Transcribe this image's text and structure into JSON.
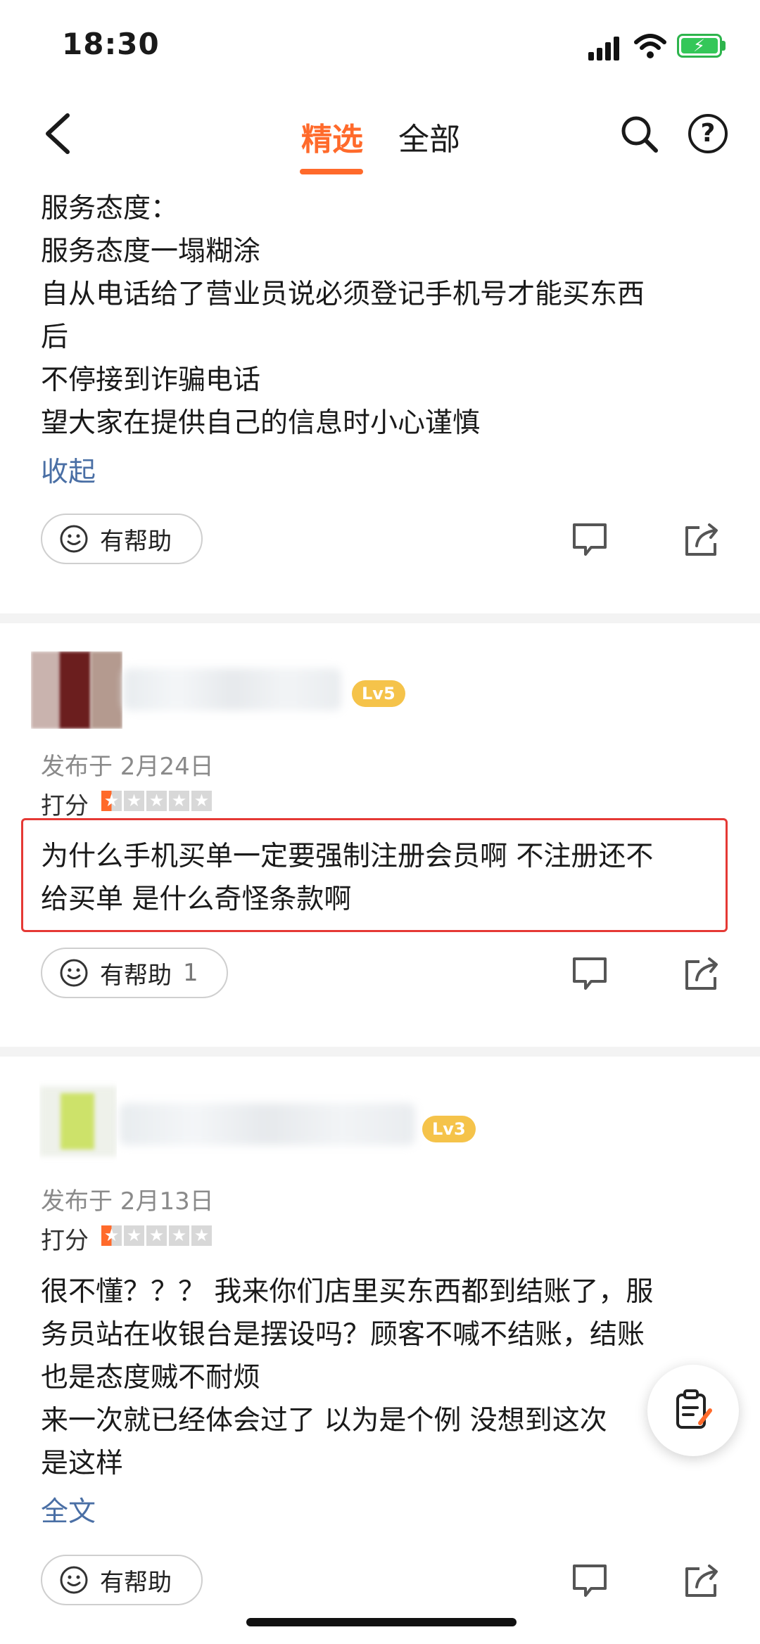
{
  "status_bar": {
    "time": "18:30"
  },
  "nav": {
    "tab_selected": "精选",
    "tab_all": "全部",
    "help_symbol": "?"
  },
  "review1": {
    "lines": [
      "服务态度：",
      "服务态度一塌糊涂",
      "自从电话给了营业员说必须登记手机号才能买东西",
      "后",
      "不停接到诈骗电话",
      "望大家在提供自己的信息时小心谨慎"
    ],
    "collapse": "收起",
    "helpful": "有帮助"
  },
  "review2": {
    "level": "Lv5",
    "date": "发布于 2月24日",
    "score_label": "打分",
    "rating": 1,
    "lines": [
      "为什么手机买单一定要强制注册会员啊 不注册还不",
      "给买单 是什么奇怪条款啊"
    ],
    "helpful": "有帮助",
    "helpful_count": "1"
  },
  "review3": {
    "level": "Lv3",
    "date": "发布于 2月13日",
    "score_label": "打分",
    "rating": 1,
    "lines": [
      "很不懂？？？ 我来你们店里买东西都到结账了，服",
      "务员站在收银台是摆设吗？顾客不喊不结账，结账",
      "也是态度贼不耐烦",
      "来一次就已经体会过了 以为是个例 没想到这次",
      "是这样"
    ],
    "full_text": "全文",
    "helpful": "有帮助"
  },
  "colors": {
    "accent": "#ff6a2b",
    "link": "#4a6fa5",
    "level_badge": "#f5c34a",
    "highlight_box": "#e53935"
  }
}
